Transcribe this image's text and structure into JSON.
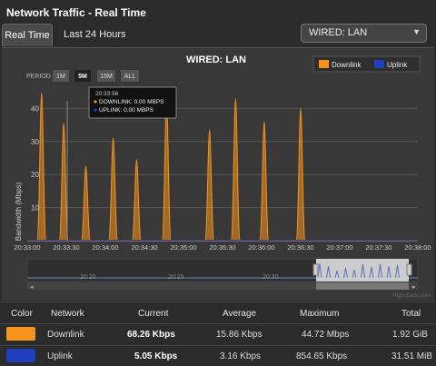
{
  "header": {
    "title": "Network Traffic - Real Time"
  },
  "tabs": [
    {
      "label": "Real Time"
    },
    {
      "label": "Last 24 Hours"
    }
  ],
  "interface_select": {
    "value": "WIRED: LAN"
  },
  "chart_panel": {
    "title": "WIRED: LAN",
    "period_label": "PERIOD",
    "period_buttons": [
      "1M",
      "5M",
      "15M",
      "ALL"
    ],
    "period_selected": "5M",
    "legend": [
      {
        "name": "Downlink",
        "color": "#f7941d"
      },
      {
        "name": "Uplink",
        "color": "#1f3fbf"
      }
    ],
    "tooltip": {
      "time": "20:33:56",
      "downlink": "DOWNLINK: 0.00 MBPS",
      "uplink": "UPLINK: 0.00 MBPS"
    },
    "navigator_labels": [
      "20:20",
      "20:25",
      "20:30"
    ],
    "watermark": "Highcharts.com"
  },
  "chart_data": {
    "type": "area",
    "title": "WIRED: LAN",
    "xlabel": "",
    "ylabel": "Bandwidth (Mbps)",
    "ylim": [
      0,
      50
    ],
    "yticks": [
      10,
      20,
      30,
      40
    ],
    "xticks": [
      "20:33:00",
      "20:33:30",
      "20:34:00",
      "20:34:30",
      "20:35:00",
      "20:35:30",
      "20:36:00",
      "20:36:30",
      "20:37:00",
      "20:37:30",
      "20:38:00"
    ],
    "series": [
      {
        "name": "Downlink",
        "color": "#f7941d",
        "peaks": [
          {
            "time": "20:33:11",
            "value": 44.7
          },
          {
            "time": "20:33:28",
            "value": 35.5
          },
          {
            "time": "20:33:45",
            "value": 22.5
          },
          {
            "time": "20:34:06",
            "value": 31.0
          },
          {
            "time": "20:34:24",
            "value": 24.5
          },
          {
            "time": "20:34:47",
            "value": 42.0
          },
          {
            "time": "20:35:20",
            "value": 33.5
          },
          {
            "time": "20:35:40",
            "value": 43.0
          },
          {
            "time": "20:36:02",
            "value": 36.0
          },
          {
            "time": "20:36:30",
            "value": 40.0
          }
        ]
      },
      {
        "name": "Uplink",
        "color": "#1f3fbf",
        "values": [
          0
        ]
      }
    ]
  },
  "table": {
    "headers": [
      "Color",
      "Network",
      "Current",
      "Average",
      "Maximum",
      "Total"
    ],
    "rows": [
      {
        "color": "#f7941d",
        "network": "Downlink",
        "current": "68.26 Kbps",
        "average": "15.86 Kbps",
        "maximum": "44.72 Mbps",
        "total": "1.92 GiB"
      },
      {
        "color": "#1f3fbf",
        "network": "Uplink",
        "current": "5.05 Kbps",
        "average": "3.16 Kbps",
        "maximum": "854.65 Kbps",
        "total": "31.51 MiB"
      }
    ]
  }
}
